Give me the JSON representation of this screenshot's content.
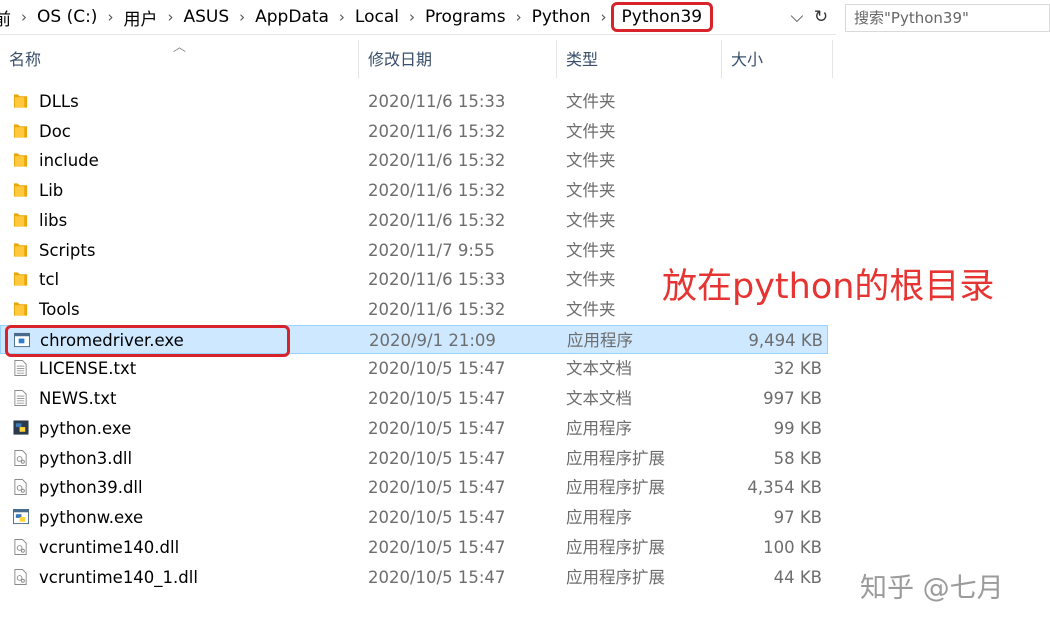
{
  "address_bar": {
    "crumbs": [
      "前",
      "OS (C:)",
      "用户",
      "ASUS",
      "AppData",
      "Local",
      "Programs",
      "Python",
      "Python39"
    ],
    "search_placeholder": "搜索\"Python39\""
  },
  "columns": {
    "name": "名称",
    "date": "修改日期",
    "type": "类型",
    "size": "大小"
  },
  "files": [
    {
      "name": "DLLs",
      "date": "2020/11/6 15:33",
      "type": "文件夹",
      "size": "",
      "icon": "folder-icon"
    },
    {
      "name": "Doc",
      "date": "2020/11/6 15:32",
      "type": "文件夹",
      "size": "",
      "icon": "folder-icon"
    },
    {
      "name": "include",
      "date": "2020/11/6 15:32",
      "type": "文件夹",
      "size": "",
      "icon": "folder-icon"
    },
    {
      "name": "Lib",
      "date": "2020/11/6 15:32",
      "type": "文件夹",
      "size": "",
      "icon": "folder-icon"
    },
    {
      "name": "libs",
      "date": "2020/11/6 15:32",
      "type": "文件夹",
      "size": "",
      "icon": "folder-icon"
    },
    {
      "name": "Scripts",
      "date": "2020/11/7 9:55",
      "type": "文件夹",
      "size": "",
      "icon": "folder-icon"
    },
    {
      "name": "tcl",
      "date": "2020/11/6 15:33",
      "type": "文件夹",
      "size": "",
      "icon": "folder-icon"
    },
    {
      "name": "Tools",
      "date": "2020/11/6 15:32",
      "type": "文件夹",
      "size": "",
      "icon": "folder-icon"
    },
    {
      "name": "chromedriver.exe",
      "date": "2020/9/1 21:09",
      "type": "应用程序",
      "size": "9,494 KB",
      "icon": "app-icon",
      "selected": true
    },
    {
      "name": "LICENSE.txt",
      "date": "2020/10/5 15:47",
      "type": "文本文档",
      "size": "32 KB",
      "icon": "text-file-icon"
    },
    {
      "name": "NEWS.txt",
      "date": "2020/10/5 15:47",
      "type": "文本文档",
      "size": "997 KB",
      "icon": "text-file-icon"
    },
    {
      "name": "python.exe",
      "date": "2020/10/5 15:47",
      "type": "应用程序",
      "size": "99 KB",
      "icon": "python-exe-icon"
    },
    {
      "name": "python3.dll",
      "date": "2020/10/5 15:47",
      "type": "应用程序扩展",
      "size": "58 KB",
      "icon": "dll-file-icon"
    },
    {
      "name": "python39.dll",
      "date": "2020/10/5 15:47",
      "type": "应用程序扩展",
      "size": "4,354 KB",
      "icon": "dll-file-icon"
    },
    {
      "name": "pythonw.exe",
      "date": "2020/10/5 15:47",
      "type": "应用程序",
      "size": "97 KB",
      "icon": "pythonw-exe-icon"
    },
    {
      "name": "vcruntime140.dll",
      "date": "2020/10/5 15:47",
      "type": "应用程序扩展",
      "size": "100 KB",
      "icon": "dll-file-icon"
    },
    {
      "name": "vcruntime140_1.dll",
      "date": "2020/10/5 15:47",
      "type": "应用程序扩展",
      "size": "44 KB",
      "icon": "dll-file-icon"
    }
  ],
  "annotation": {
    "text": "放在python的根目录"
  },
  "watermark": {
    "text": "知乎 @七月"
  },
  "colors": {
    "highlight_red": "#d9232a",
    "annotation_red": "#e53431",
    "selection": "#cde8ff",
    "folder": "#ffc83d"
  }
}
